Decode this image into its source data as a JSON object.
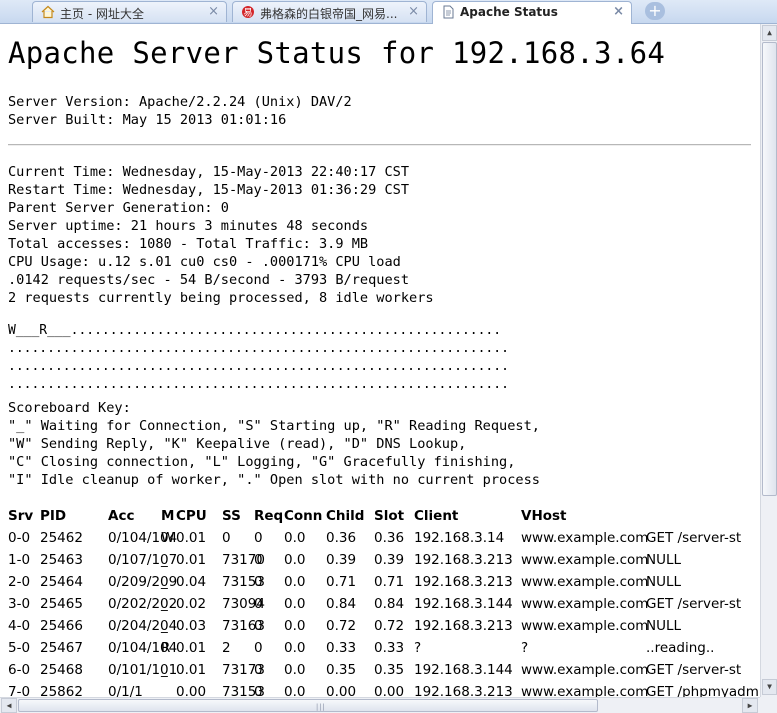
{
  "browser": {
    "tabs": [
      {
        "label": "主页 - 网址大全",
        "icon": "home-icon",
        "active": false
      },
      {
        "label": "弗格森的白银帝国_网易...",
        "icon": "news-site-icon",
        "active": false
      },
      {
        "label": "Apache Status",
        "icon": "page-icon",
        "active": true
      }
    ],
    "close_glyph": "×",
    "new_tab_glyph": "+"
  },
  "page": {
    "title": "Apache Server Status for 192.168.3.64",
    "server_version": "Server Version: Apache/2.2.24 (Unix) DAV/2",
    "server_built": "Server Built: May 15 2013 01:01:16",
    "current_time": "Current Time: Wednesday, 15-May-2013 22:40:17 CST",
    "restart_time": "Restart Time: Wednesday, 15-May-2013 01:36:29 CST",
    "parent_generation": "Parent Server Generation: 0",
    "uptime": "Server uptime: 21 hours 3 minutes 48 seconds",
    "accesses": "Total accesses: 1080 - Total Traffic: 3.9 MB",
    "cpu_usage": "CPU Usage: u.12 s.01 cu0 cs0 - .000171% CPU load",
    "rates": ".0142 requests/sec - 54 B/second - 3793 B/request",
    "requests": "2 requests currently being processed, 8 idle workers",
    "scoreboard": [
      "W___R___.......................................................",
      "................................................................",
      "................................................................",
      "................................................................"
    ],
    "key_title": "Scoreboard Key:",
    "key_lines": [
      "\"_\" Waiting for Connection, \"S\" Starting up, \"R\" Reading Request,",
      "\"W\" Sending Reply, \"K\" Keepalive (read), \"D\" DNS Lookup,",
      "\"C\" Closing connection, \"L\" Logging, \"G\" Gracefully finishing,",
      "\"I\" Idle cleanup of worker, \".\" Open slot with no current process"
    ]
  },
  "workers": {
    "headers": [
      "Srv",
      "PID",
      "Acc",
      "M",
      "CPU",
      "SS",
      "Req",
      "Conn",
      "Child",
      "Slot",
      "Client",
      "VHost",
      ""
    ],
    "rows": [
      [
        "0-0",
        "25462",
        "0/104/104",
        "W",
        "0.01",
        "0",
        "0",
        "0.0",
        "0.36",
        "0.36",
        "192.168.3.14",
        "www.example.com",
        "GET /server-st"
      ],
      [
        "1-0",
        "25463",
        "0/107/107",
        "_",
        "0.01",
        "73170",
        "0",
        "0.0",
        "0.39",
        "0.39",
        "192.168.3.213",
        "www.example.com",
        "NULL"
      ],
      [
        "2-0",
        "25464",
        "0/209/209",
        "_",
        "0.04",
        "73153",
        "0",
        "0.0",
        "0.71",
        "0.71",
        "192.168.3.213",
        "www.example.com",
        "NULL"
      ],
      [
        "3-0",
        "25465",
        "0/202/202",
        "_",
        "0.02",
        "73094",
        "0",
        "0.0",
        "0.84",
        "0.84",
        "192.168.3.144",
        "www.example.com",
        "GET /server-st"
      ],
      [
        "4-0",
        "25466",
        "0/204/204",
        "_",
        "0.03",
        "73163",
        "0",
        "0.0",
        "0.72",
        "0.72",
        "192.168.3.213",
        "www.example.com",
        "NULL"
      ],
      [
        "5-0",
        "25467",
        "0/104/104",
        "R",
        "0.01",
        "2",
        "0",
        "0.0",
        "0.33",
        "0.33",
        "?",
        "?",
        "..reading.."
      ],
      [
        "6-0",
        "25468",
        "0/101/101",
        "_",
        "0.01",
        "73173",
        "0",
        "0.0",
        "0.35",
        "0.35",
        "192.168.3.144",
        "www.example.com",
        "GET /server-st"
      ],
      [
        "7-0",
        "25862",
        "0/1/1",
        "_",
        "0.00",
        "73153",
        "0",
        "0.0",
        "0.00",
        "0.00",
        "192.168.3.213",
        "www.example.com",
        "GET /phpmyadmi"
      ]
    ]
  }
}
